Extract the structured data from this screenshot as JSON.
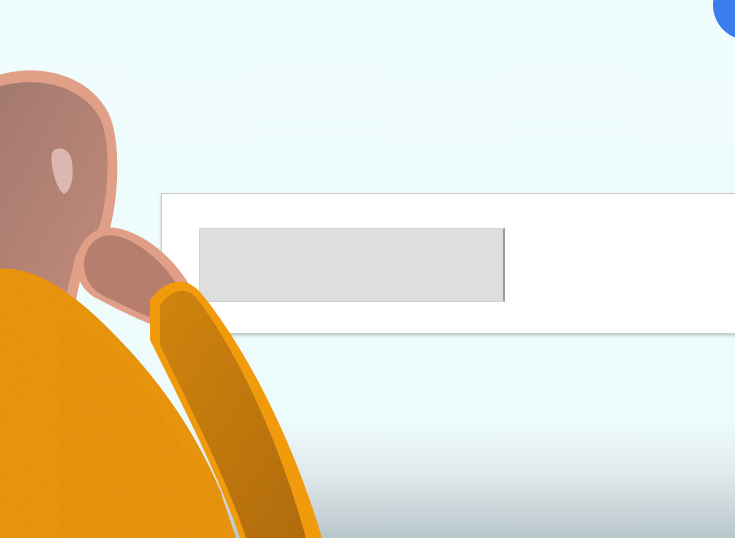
{
  "search": {
    "value": "",
    "placeholder": ""
  },
  "colors": {
    "background": "#f0fdfd",
    "card": "#ffffff",
    "input": "#dedede",
    "blue_accent": "#3b7ded",
    "skin": "#b98877",
    "skin_outline": "#e09f86",
    "sweater": "#f09a0c",
    "sweater_dark": "#c7760c"
  },
  "icons": {
    "person": "thinking-person-illustration",
    "accent": "blue-circle-decoration"
  }
}
